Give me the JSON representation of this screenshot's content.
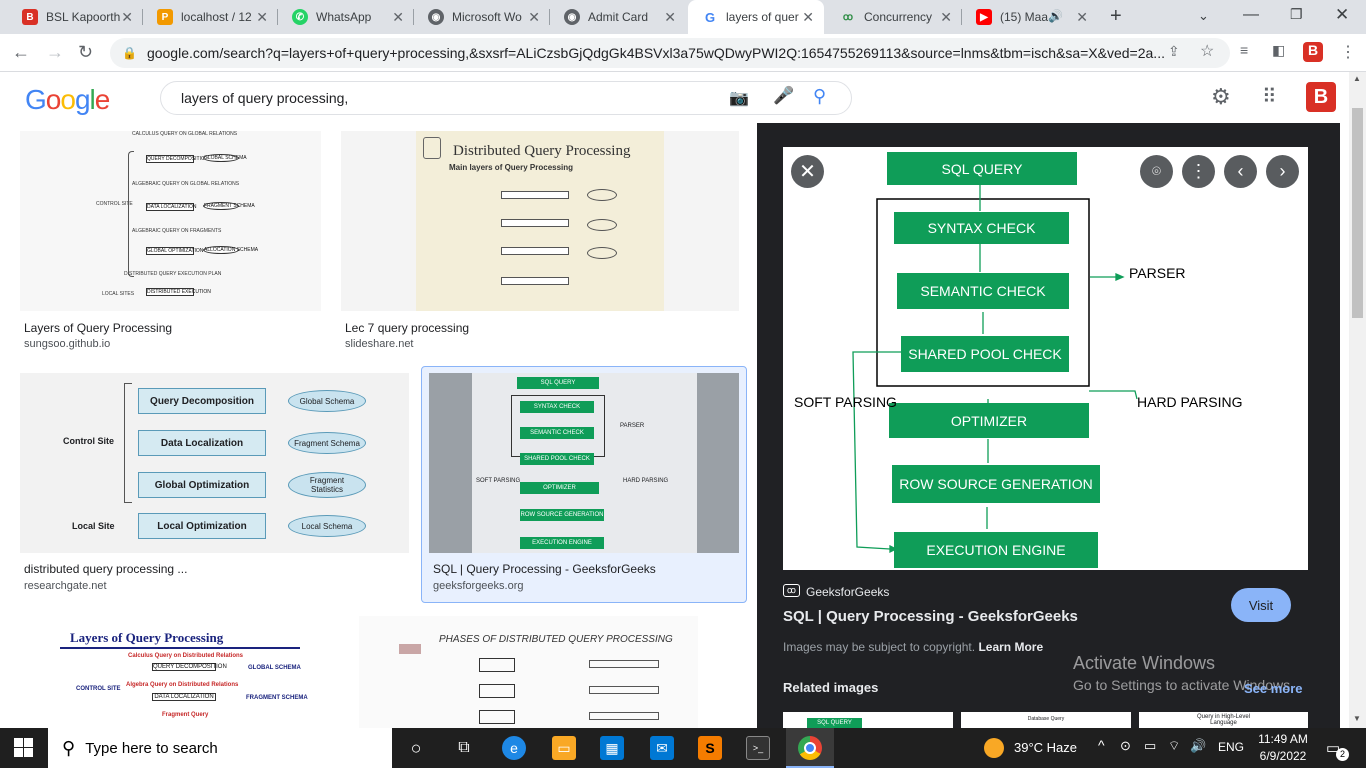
{
  "tabs": [
    {
      "label": "BSL Kapoorth",
      "color": "#d93025",
      "icon": "B"
    },
    {
      "label": "localhost / 12",
      "color": "#f29900",
      "icon": "P"
    },
    {
      "label": "WhatsApp",
      "color": "#25d366",
      "icon": "W"
    },
    {
      "label": "Microsoft Wo",
      "color": "#5f6368",
      "icon": "◉"
    },
    {
      "label": "Admit Card",
      "color": "#5f6368",
      "icon": "◉"
    },
    {
      "label": "layers of quer",
      "color": "#4285f4",
      "icon": "G"
    },
    {
      "label": "Concurrency",
      "color": "#2f8d46",
      "icon": "gg"
    },
    {
      "label": "(15) Maa",
      "color": "#ff0000",
      "icon": "▶"
    }
  ],
  "address": {
    "url": "google.com/search?q=layers+of+query+processing,&sxsrf=ALiCzsbGjQdgGk4BSVxl3a75wQDwyPWI2Q:1654755269113&source=lnms&tbm=isch&sa=X&ved=2a..."
  },
  "google": {
    "logo": "Google",
    "query": "layers of query processing,"
  },
  "results": [
    {
      "caption": "Layers of Query Processing",
      "source": "sungsoo.github.io"
    },
    {
      "caption": "Lec 7 query processing",
      "source": "slideshare.net"
    },
    {
      "caption": "distributed query processing ...",
      "source": "researchgate.net"
    },
    {
      "caption": "SQL | Query Processing - GeeksforGeeks",
      "source": "geeksforgeeks.org"
    }
  ],
  "thumb1": {
    "top": "CALCULUS QUERY ON GLOBAL RELATIONS",
    "b1": "QUERY DECOMPOSITION",
    "s1": "GLOBAL SCHEMA",
    "m1": "ALGEBRAIC QUERY ON GLOBAL RELATIONS",
    "b2": "DATA LOCALIZATION",
    "s2": "FRAGMENT SCHEMA",
    "m2": "ALGEBRAIC QUERY ON FRAGMENTS",
    "b3": "GLOBAL OPTIMIZATION",
    "s3": "ALLOCATION SCHEMA",
    "m3": "DISTRIBUTED QUERY EXECUTION PLAN",
    "b4": "DISTRIBUTED EXECUTION",
    "control": "CONTROL SITE",
    "local": "LOCAL SITES"
  },
  "thumb2": {
    "title": "Distributed Query Processing",
    "sub": "Main layers of Query Processing"
  },
  "thumb3": {
    "b1": "Query Decomposition",
    "s1": "Global Schema",
    "b2": "Data Localization",
    "s2": "Fragment Schema",
    "b3": "Global Optimization",
    "s3": "Fragment Statistics",
    "b4": "Local Optimization",
    "s4": "Local Schema",
    "control": "Control Site",
    "local": "Local Site"
  },
  "thumb5": {
    "title": "Layers of Query Processing",
    "l1": "Calculus Query on Distributed Relations",
    "b1": "QUERY DECOMPOSITION",
    "s1": "GLOBAL SCHEMA",
    "l2": "Algebra Query on Distributed Relations",
    "b2": "DATA LOCALIZATION",
    "s2": "FRAGMENT SCHEMA",
    "l3": "Fragment Query",
    "control": "CONTROL SITE"
  },
  "thumb6": {
    "title": "PHASES OF DISTRIBUTED QUERY PROCESSING"
  },
  "preview": {
    "boxes": [
      "SQL QUERY",
      "SYNTAX CHECK",
      "SEMANTIC CHECK",
      "SHARED POOL CHECK",
      "OPTIMIZER",
      "ROW SOURCE GENERATION",
      "EXECUTION ENGINE"
    ],
    "parser": "PARSER",
    "soft": "SOFT PARSING",
    "hard": "HARD PARSING",
    "site": "GeeksforGeeks",
    "title": "SQL | Query Processing - GeeksforGeeks",
    "visit": "Visit",
    "copyright": "Images may be subject to copyright.",
    "learn_more": "Learn More",
    "related": "Related images",
    "see_more": "See more",
    "activate1": "Activate Windows",
    "activate2": "Go to Settings to activate Windows.",
    "rel1": "SQL QUERY",
    "rel2": "Database Query",
    "rel3": "Query in High-Level Language"
  },
  "taskbar": {
    "search": "Type here to search",
    "weather": "39°C  Haze",
    "lang": "ENG",
    "time": "11:49 AM",
    "date": "6/9/2022",
    "notif": "2"
  }
}
